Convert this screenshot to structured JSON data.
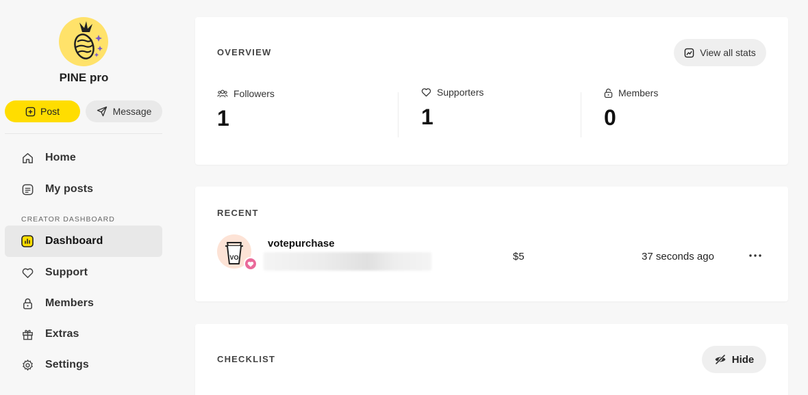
{
  "profile": {
    "name": "PINE pro",
    "avatar_icon": "pineapple-avatar",
    "post_label": "Post",
    "message_label": "Message"
  },
  "nav": {
    "home": "Home",
    "my_posts": "My posts",
    "section_label": "CREATOR DASHBOARD",
    "dashboard": "Dashboard",
    "support": "Support",
    "members": "Members",
    "extras": "Extras",
    "settings": "Settings"
  },
  "overview": {
    "title": "OVERVIEW",
    "view_stats_label": "View all stats",
    "stats": [
      {
        "label": "Followers",
        "value": "1",
        "icon": "followers-icon"
      },
      {
        "label": "Supporters",
        "value": "1",
        "icon": "heart-icon"
      },
      {
        "label": "Members",
        "value": "0",
        "icon": "lock-icon"
      }
    ]
  },
  "recent": {
    "title": "RECENT",
    "item": {
      "name": "votepurchase",
      "amount": "$5",
      "time": "37 seconds ago",
      "avatar_text": "VO"
    }
  },
  "checklist": {
    "title": "CHECKLIST",
    "hide_label": "Hide"
  },
  "colors": {
    "accent": "#ffdd00",
    "background": "#f7f7f7",
    "heart_badge": "#ea6a9a"
  }
}
